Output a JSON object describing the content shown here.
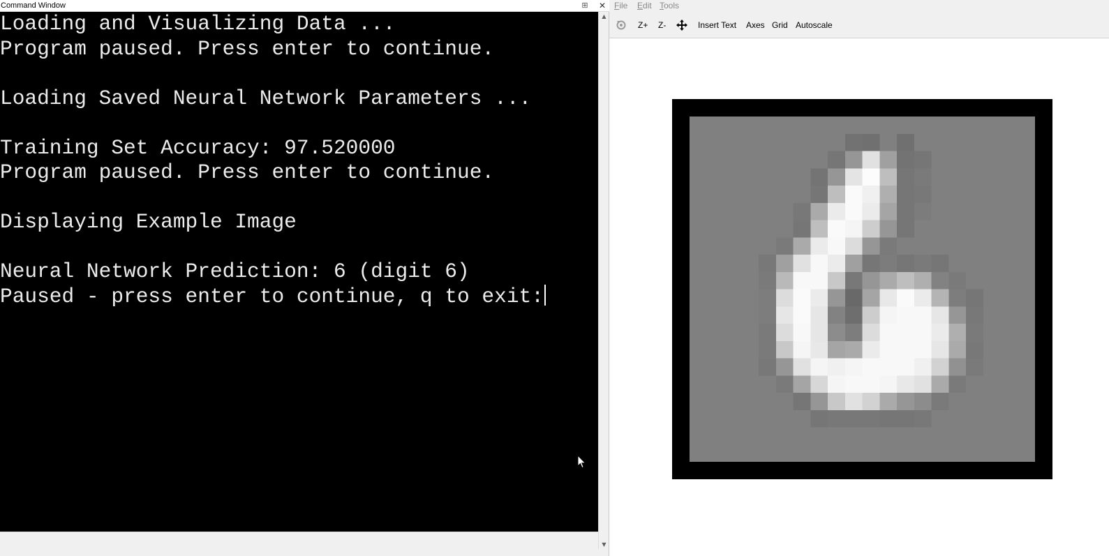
{
  "command_window": {
    "title": "Command Window",
    "lines": [
      "Loading and Visualizing Data ...",
      "Program paused. Press enter to continue.",
      "",
      "Loading Saved Neural Network Parameters ...",
      "",
      "Training Set Accuracy: 97.520000",
      "Program paused. Press enter to continue.",
      "",
      "Displaying Example Image",
      "",
      "Neural Network Prediction: 6 (digit 6)",
      "Paused - press enter to continue, q to exit:"
    ],
    "close_glyph": "✕",
    "undock_glyph": "⊞",
    "background": "#000000",
    "foreground": "#ececec"
  },
  "figure_window": {
    "menu": [
      {
        "label": "File",
        "accel": "F"
      },
      {
        "label": "Edit",
        "accel": "E"
      },
      {
        "label": "Tools",
        "accel": "T"
      }
    ],
    "toolbar": {
      "rotate_icon": "rotate-icon",
      "zoom_in": "Z+",
      "zoom_out": "Z-",
      "pan_icon": "pan-icon",
      "insert_text": "Insert Text",
      "axes": "Axes",
      "grid": "Grid",
      "autoscale": "Autoscale"
    },
    "image": {
      "description_note": "",
      "grid_cols": 20,
      "grid_rows": 20,
      "background_level": 128,
      "pixels": [
        [
          9,
          8,
          200,
          200,
          200
        ],
        [
          8,
          8,
          114
        ],
        [
          8,
          9,
          112
        ],
        [
          8,
          10,
          128
        ],
        [
          8,
          11,
          112
        ],
        [
          9,
          8,
          128
        ],
        [
          9,
          9,
          150
        ],
        [
          9,
          10,
          225
        ],
        [
          9,
          11,
          160
        ],
        [
          9,
          12,
          115
        ],
        [
          9,
          13,
          118
        ],
        [
          10,
          7,
          116
        ],
        [
          10,
          8,
          150
        ],
        [
          10,
          9,
          228
        ],
        [
          10,
          10,
          252
        ],
        [
          10,
          11,
          190
        ],
        [
          10,
          12,
          118
        ],
        [
          10,
          13,
          122
        ],
        [
          11,
          7,
          118
        ],
        [
          11,
          8,
          190
        ],
        [
          11,
          9,
          250
        ],
        [
          11,
          10,
          240
        ],
        [
          11,
          11,
          175
        ],
        [
          11,
          12,
          118
        ],
        [
          11,
          13,
          120
        ],
        [
          12,
          6,
          120
        ],
        [
          12,
          7,
          170
        ],
        [
          12,
          8,
          235
        ],
        [
          12,
          9,
          250
        ],
        [
          12,
          10,
          235
        ],
        [
          12,
          11,
          165
        ],
        [
          12,
          12,
          118
        ],
        [
          12,
          13,
          124
        ],
        [
          13,
          6,
          118
        ],
        [
          13,
          7,
          190
        ],
        [
          13,
          8,
          250
        ],
        [
          13,
          9,
          245
        ],
        [
          13,
          10,
          205
        ],
        [
          13,
          11,
          150
        ],
        [
          13,
          12,
          118
        ],
        [
          14,
          5,
          122
        ],
        [
          14,
          6,
          170
        ],
        [
          14,
          7,
          235
        ],
        [
          14,
          8,
          248
        ],
        [
          14,
          9,
          220
        ],
        [
          14,
          10,
          150
        ],
        [
          14,
          11,
          122
        ],
        [
          15,
          4,
          120
        ],
        [
          15,
          5,
          160
        ],
        [
          15,
          6,
          225
        ],
        [
          15,
          7,
          248
        ],
        [
          15,
          8,
          235
        ],
        [
          15,
          9,
          160
        ],
        [
          15,
          10,
          118
        ],
        [
          15,
          11,
          124
        ],
        [
          15,
          12,
          118
        ],
        [
          15,
          13,
          122
        ],
        [
          15,
          14,
          118
        ],
        [
          16,
          4,
          122
        ],
        [
          16,
          5,
          185
        ],
        [
          16,
          6,
          248
        ],
        [
          16,
          7,
          248
        ],
        [
          16,
          8,
          200
        ],
        [
          16,
          9,
          120
        ],
        [
          16,
          10,
          150
        ],
        [
          16,
          11,
          170
        ],
        [
          16,
          12,
          190
        ],
        [
          16,
          13,
          175
        ],
        [
          16,
          14,
          130
        ],
        [
          16,
          15,
          122
        ],
        [
          17,
          4,
          125
        ],
        [
          17,
          5,
          220
        ],
        [
          17,
          6,
          250
        ],
        [
          17,
          7,
          235
        ],
        [
          17,
          8,
          150
        ],
        [
          17,
          9,
          105
        ],
        [
          17,
          10,
          165
        ],
        [
          17,
          11,
          232
        ],
        [
          17,
          12,
          250
        ],
        [
          17,
          13,
          235
        ],
        [
          17,
          14,
          180
        ],
        [
          17,
          15,
          125
        ],
        [
          17,
          16,
          118
        ],
        [
          18,
          4,
          125
        ],
        [
          18,
          5,
          230
        ],
        [
          18,
          6,
          250
        ],
        [
          18,
          7,
          230
        ],
        [
          18,
          8,
          130
        ],
        [
          18,
          9,
          110
        ],
        [
          18,
          10,
          205
        ],
        [
          18,
          11,
          245
        ],
        [
          18,
          12,
          248
        ],
        [
          18,
          13,
          248
        ],
        [
          18,
          14,
          230
        ],
        [
          18,
          15,
          150
        ],
        [
          18,
          16,
          120
        ],
        [
          19,
          4,
          122
        ],
        [
          19,
          5,
          220
        ],
        [
          19,
          6,
          248
        ],
        [
          19,
          7,
          230
        ],
        [
          19,
          8,
          140
        ],
        [
          19,
          9,
          125
        ],
        [
          19,
          10,
          220
        ],
        [
          19,
          11,
          248
        ],
        [
          19,
          12,
          248
        ],
        [
          19,
          13,
          248
        ],
        [
          19,
          14,
          235
        ],
        [
          19,
          15,
          175
        ],
        [
          19,
          16,
          122
        ]
      ],
      "rows": [
        [
          128,
          128,
          128,
          128,
          128,
          128,
          128,
          128,
          128,
          128,
          128,
          128,
          128,
          128,
          128,
          128,
          128,
          128,
          128,
          128
        ],
        [
          128,
          128,
          128,
          128,
          128,
          128,
          128,
          128,
          128,
          114,
          112,
          128,
          112,
          128,
          128,
          128,
          128,
          128,
          128,
          128
        ],
        [
          128,
          128,
          128,
          128,
          128,
          128,
          128,
          128,
          118,
          150,
          225,
          160,
          115,
          118,
          128,
          128,
          128,
          128,
          128,
          128
        ],
        [
          128,
          128,
          128,
          128,
          128,
          128,
          128,
          116,
          150,
          228,
          252,
          190,
          118,
          122,
          128,
          128,
          128,
          128,
          128,
          128
        ],
        [
          128,
          128,
          128,
          128,
          128,
          128,
          128,
          118,
          190,
          250,
          240,
          175,
          118,
          120,
          128,
          128,
          128,
          128,
          128,
          128
        ],
        [
          128,
          128,
          128,
          128,
          128,
          128,
          120,
          170,
          235,
          250,
          235,
          165,
          118,
          124,
          128,
          128,
          128,
          128,
          128,
          128
        ],
        [
          128,
          128,
          128,
          128,
          128,
          128,
          118,
          190,
          250,
          245,
          205,
          150,
          118,
          128,
          128,
          128,
          128,
          128,
          128,
          128
        ],
        [
          128,
          128,
          128,
          128,
          128,
          122,
          170,
          235,
          248,
          220,
          150,
          122,
          128,
          128,
          128,
          128,
          128,
          128,
          128,
          128
        ],
        [
          128,
          128,
          128,
          128,
          120,
          160,
          225,
          248,
          235,
          160,
          118,
          124,
          118,
          122,
          118,
          128,
          128,
          128,
          128,
          128
        ],
        [
          128,
          128,
          128,
          128,
          122,
          185,
          248,
          248,
          200,
          120,
          150,
          170,
          190,
          175,
          130,
          122,
          128,
          128,
          128,
          128
        ],
        [
          128,
          128,
          128,
          128,
          125,
          220,
          250,
          235,
          150,
          105,
          165,
          232,
          250,
          235,
          180,
          125,
          118,
          128,
          128,
          128
        ],
        [
          128,
          128,
          128,
          128,
          125,
          230,
          250,
          230,
          130,
          110,
          205,
          245,
          248,
          248,
          230,
          150,
          120,
          128,
          128,
          128
        ],
        [
          128,
          128,
          128,
          128,
          122,
          220,
          248,
          230,
          140,
          125,
          220,
          248,
          248,
          248,
          235,
          175,
          122,
          128,
          128,
          128
        ],
        [
          128,
          128,
          128,
          128,
          122,
          200,
          245,
          232,
          165,
          170,
          235,
          248,
          248,
          248,
          230,
          170,
          120,
          128,
          128,
          128
        ],
        [
          128,
          128,
          128,
          128,
          120,
          150,
          225,
          245,
          240,
          245,
          248,
          248,
          248,
          240,
          210,
          145,
          122,
          128,
          128,
          128
        ],
        [
          128,
          128,
          128,
          128,
          128,
          122,
          165,
          215,
          245,
          248,
          248,
          245,
          232,
          225,
          170,
          122,
          128,
          128,
          128,
          128
        ],
        [
          128,
          128,
          128,
          128,
          128,
          128,
          118,
          150,
          200,
          225,
          210,
          170,
          150,
          140,
          122,
          128,
          128,
          128,
          128,
          128
        ],
        [
          128,
          128,
          128,
          128,
          128,
          128,
          128,
          118,
          120,
          120,
          120,
          118,
          118,
          120,
          128,
          128,
          128,
          128,
          128,
          128
        ],
        [
          128,
          128,
          128,
          128,
          128,
          128,
          128,
          128,
          128,
          128,
          128,
          128,
          128,
          128,
          128,
          128,
          128,
          128,
          128,
          128
        ],
        [
          128,
          128,
          128,
          128,
          128,
          128,
          128,
          128,
          128,
          128,
          128,
          128,
          128,
          128,
          128,
          128,
          128,
          128,
          128,
          128
        ]
      ]
    }
  }
}
